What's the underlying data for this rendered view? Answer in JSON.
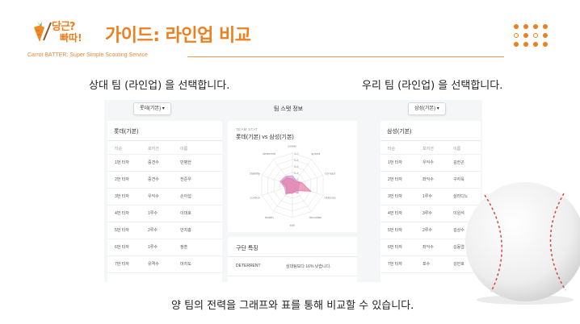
{
  "header": {
    "logo_line1": "당근?",
    "logo_line2": "빠따!",
    "title": "가이드: 라인업 비교",
    "subtitle": "Carrot BATTER: Super Simple Scouting Service"
  },
  "captions": {
    "left": "상대 팀 (라인업) 을 선택합니다.",
    "right": "우리 팀 (라인업) 을 선택합니다.",
    "bottom": "양 팀의 전력을 그래프와 표를 통해 비교할 수 있습니다."
  },
  "screenshot": {
    "opponent_select": "롯데(기본) ▾",
    "own_select": "삼성(기본) ▾",
    "center_title": "팀 스탯 정보",
    "left_team": {
      "name": "롯데(기본)",
      "headers": [
        "타순",
        "포지션",
        "이름"
      ],
      "rows": [
        [
          "1번 타자",
          "중견수",
          "민병헌"
        ],
        [
          "2번 타자",
          "중견수",
          "전준우"
        ],
        [
          "3번 타자",
          "우익수",
          "손아섭"
        ],
        [
          "4번 타자",
          "1루수",
          "이대호"
        ],
        [
          "5번 타자",
          "2루수",
          "안치홍"
        ],
        [
          "6번 타자",
          "1루수",
          "정훈"
        ],
        [
          "7번 타자",
          "유격수",
          "마차도"
        ]
      ]
    },
    "right_team": {
      "name": "삼성(기본)",
      "headers": [
        "타순",
        "포지션",
        "이름"
      ],
      "rows": [
        [
          "1번 타자",
          "우익수",
          "김헌곤"
        ],
        [
          "2번 타자",
          "좌익수",
          "구자욱"
        ],
        [
          "3번 타자",
          "1루수",
          "살라디노"
        ],
        [
          "4번 타자",
          "3루수",
          "이원석"
        ],
        [
          "5번 타자",
          "2루수",
          "김상수"
        ],
        [
          "6번 타자",
          "좌익수",
          "김동엽"
        ],
        [
          "7번 타자",
          "포수",
          "강민호"
        ]
      ]
    },
    "stat_panel": {
      "label": "TEAM STAT",
      "versus": "롯데(기본) vs 삼성(기본)",
      "axes": [
        "power",
        "speed",
        "contact",
        "defense",
        "shoulder",
        "eye",
        "health",
        "control",
        "stability",
        "deterrent"
      ],
      "ticks": [
        "1.0",
        "0.8",
        "0.6",
        "0.4",
        "0.2"
      ],
      "series_a": [
        0.3,
        0.2,
        0.25,
        0.2,
        0.3,
        0.2,
        0.35,
        0.25,
        0.4,
        0.35
      ],
      "series_b": [
        0.2,
        0.15,
        0.3,
        0.6,
        0.2,
        0.25,
        0.3,
        0.2,
        0.35,
        0.3
      ],
      "colors": {
        "a": "#c9a0d8",
        "b": "#e87aa8"
      }
    },
    "features": {
      "title": "구단 특징",
      "key": "DETERRENT",
      "value": "삼대팀보다 16% 낮습니다."
    }
  },
  "colors": {
    "accent": "#ee7f1f"
  }
}
